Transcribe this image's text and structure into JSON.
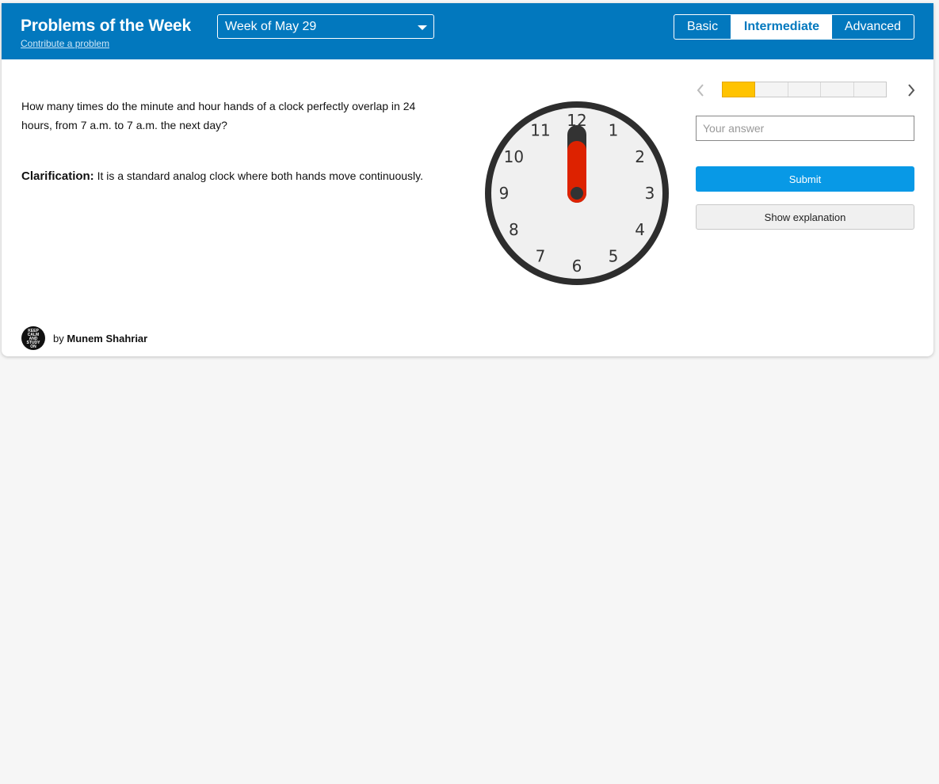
{
  "header": {
    "title": "Problems of the Week",
    "contribute_link": "Contribute a problem",
    "week_select": {
      "selected": "Week of May 29"
    },
    "levels": [
      {
        "label": "Basic",
        "active": false
      },
      {
        "label": "Intermediate",
        "active": true
      },
      {
        "label": "Advanced",
        "active": false
      }
    ]
  },
  "problem": {
    "question": "How many times do the minute and hour hands of a clock perfectly overlap in 24 hours, from 7 a.m. to 7 a.m. the next day?",
    "clarification_label": "Clarification:",
    "clarification_text": " It is a standard analog clock where both hands move continuously.",
    "clock": {
      "numbers": [
        "12",
        "1",
        "2",
        "3",
        "4",
        "5",
        "6",
        "7",
        "8",
        "9",
        "10",
        "11"
      ],
      "time_shown": "12:00",
      "hour_hand_color": "#dd2200",
      "minute_hand_color": "#333333"
    }
  },
  "answer_panel": {
    "progress": {
      "current": 1,
      "total": 5
    },
    "prev_icon": "chevron-left-icon",
    "next_icon": "chevron-right-icon",
    "answer_placeholder": "Your answer",
    "submit_label": "Submit",
    "explanation_label": "Show explanation"
  },
  "author": {
    "by_label": "by",
    "name": "Munem Shahriar",
    "avatar_text": [
      "KEEP",
      "CALM",
      "AND",
      "STUDY",
      "ON"
    ]
  },
  "colors": {
    "header_bg": "#0278be",
    "submit_bg": "#0899e6",
    "progress_fill": "#ffc300",
    "page_bg": "#f6f6f6"
  }
}
